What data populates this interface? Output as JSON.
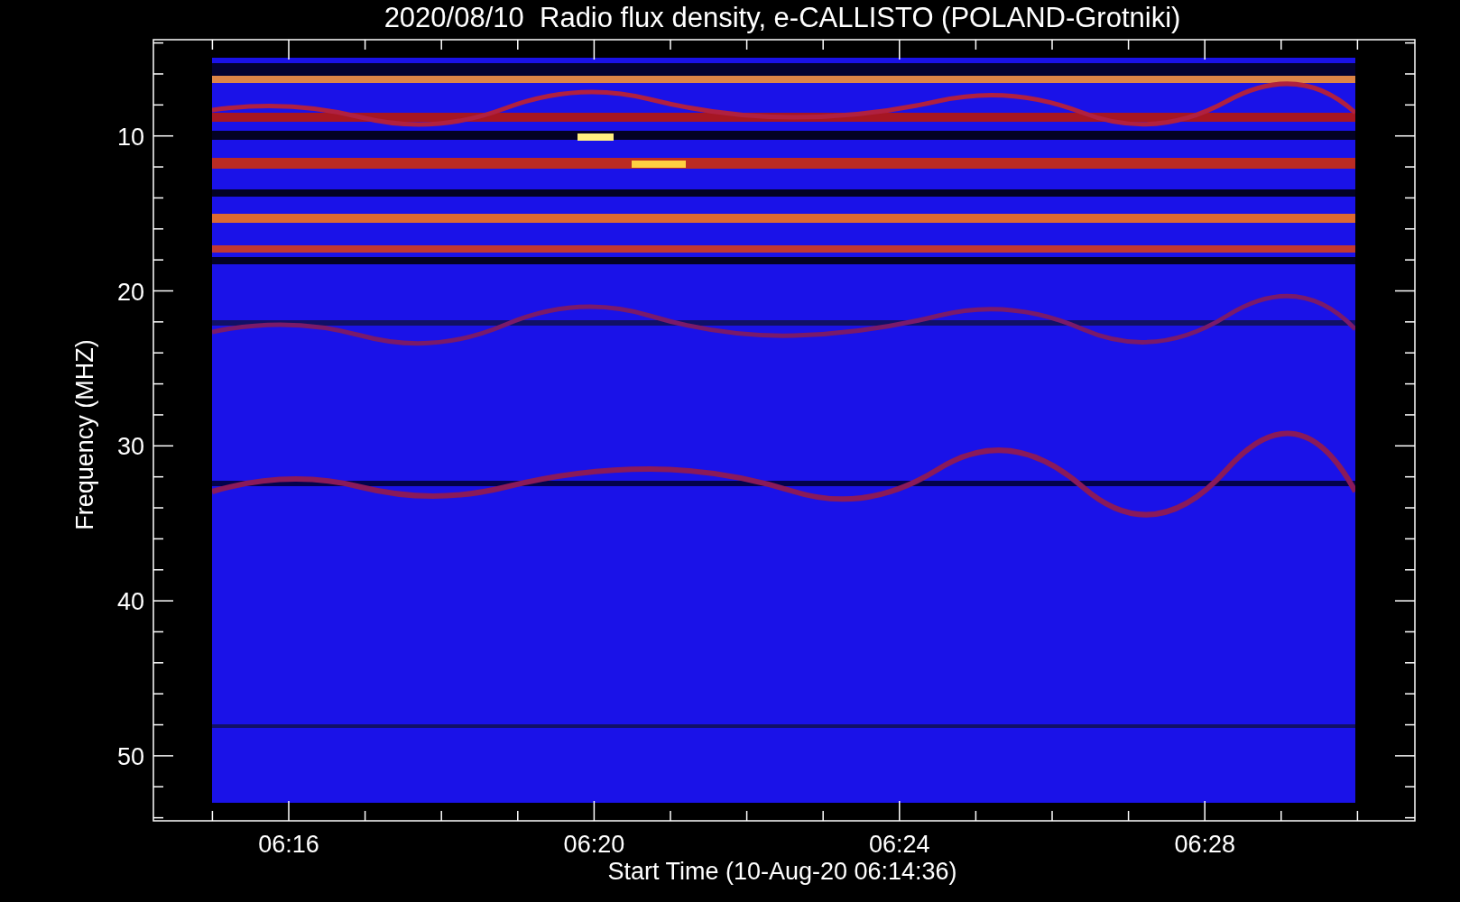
{
  "plot": {
    "title": "2020/08/10  Radio flux density, e-CALLISTO (POLAND-Grotniki)",
    "ylabel": "Frequency (MHZ)",
    "xlabel": "Start Time (10-Aug-20 06:14:36)",
    "yticks": [
      "10",
      "20",
      "30",
      "40",
      "50"
    ],
    "xticks": [
      "06:16",
      "06:20",
      "06:24",
      "06:28"
    ]
  }
}
